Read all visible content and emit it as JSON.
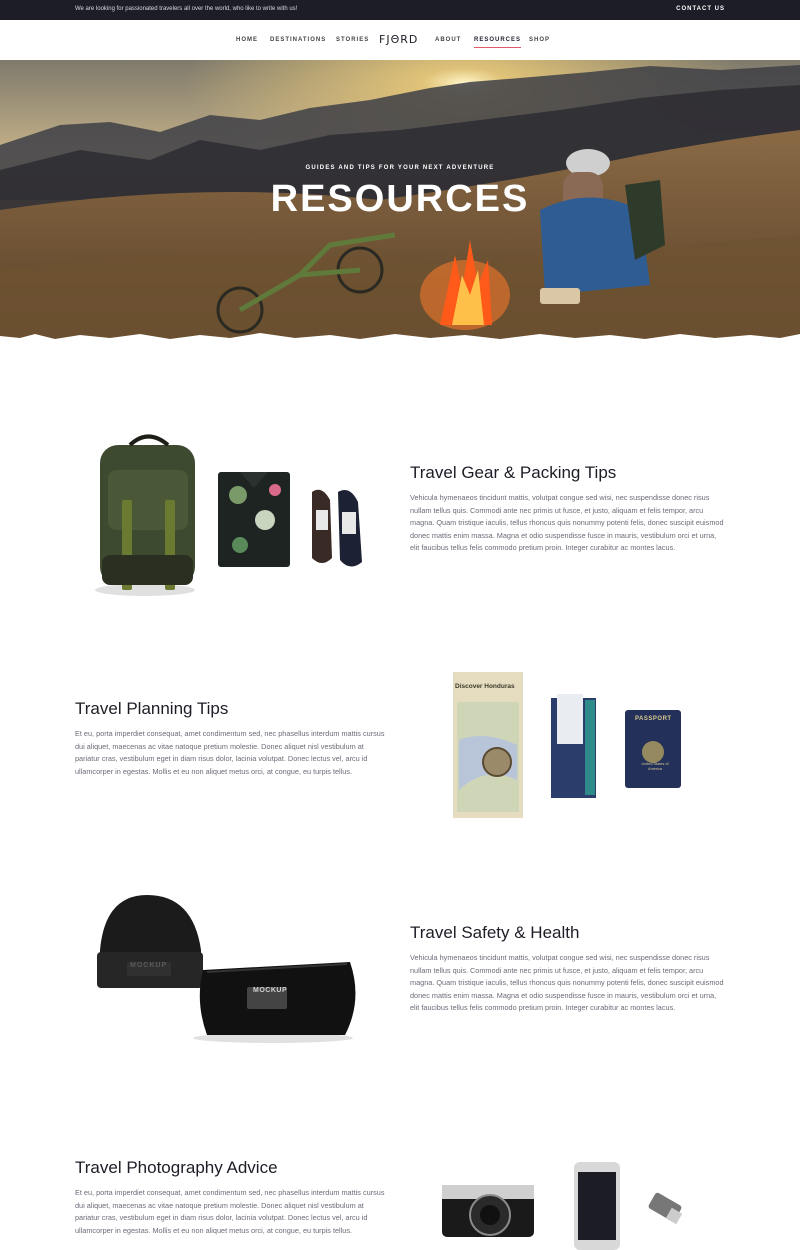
{
  "topbar": {
    "message": "We are looking for passionated travelers all over the world, who like to write with us!",
    "contact_label": "CONTACT US"
  },
  "nav": {
    "items": [
      "HOME",
      "DESTINATIONS",
      "STORIES",
      "ABOUT",
      "RESOURCES",
      "SHOP"
    ],
    "logo": "FJΘRD",
    "active": "RESOURCES"
  },
  "hero": {
    "eyebrow": "GUIDES AND TIPS FOR YOUR NEXT ADVENTURE",
    "title": "RESOURCES"
  },
  "sections": [
    {
      "title": "Travel Gear & Packing Tips",
      "body": "Vehicula hymenaeos tincidunt mattis, volutpat congue sed wisi, nec suspendisse donec risus nullam tellus quis. Commodi ante nec primis ut fusce, et justo, aliquam et felis tempor, arcu magna. Quam tristique iaculis, tellus rhoncus quis nonummy potenti felis, donec suscipit euismod donec mattis enim massa. Magna et odio suspendisse fusce in mauris, vestibulum orci et urna, elit faucibus tellus felis commodo pretium proin. Integer curabitur ac montes lacus."
    },
    {
      "title": "Travel Planning Tips",
      "body": "Et eu, porta imperdiet consequat, amet condimentum sed, nec phasellus interdum mattis cursus dui aliquet, maecenas ac vitae natoque pretium molestie. Donec aliquet nisl vestibulum at pariatur cras, vestibulum eget in diam risus dolor, lacinia volutpat. Donec lectus vel, arcu id ullamcorper in egestas. Mollis et eu non aliquet metus orci, at congue, eu turpis tellus."
    },
    {
      "title": "Travel Safety & Health",
      "body": "Vehicula hymenaeos tincidunt mattis, volutpat congue sed wisi, nec suspendisse donec risus nullam tellus quis. Commodi ante nec primis ut fusce, et justo, aliquam et felis tempor, arcu magna. Quam tristique iaculis, tellus rhoncus quis nonummy potenti felis, donec suscipit euismod donec mattis enim massa. Magna et odio suspendisse fusce in mauris, vestibulum orci et urna, elit faucibus tellus felis commodo pretium proin. Integer curabitur ac montes lacus."
    },
    {
      "title": "Travel Photography Advice",
      "body": "Et eu, porta imperdiet consequat, amet condimentum sed, nec phasellus interdum mattis cursus dui aliquet, maecenas ac vitae natoque pretium molestie. Donec aliquet nisl vestibulum at pariatur cras, vestibulum eget in diam risus dolor, lacinia volutpat. Donec lectus vel, arcu id ullamcorper in egestas. Mollis et eu non aliquet metus orci, at congue, eu turpis tellus."
    }
  ],
  "artwork_labels": {
    "map_title": "Discover Honduras",
    "passport": "PASSPORT",
    "passport_sub": "United States of America",
    "beanie_brand": "MOCKUP",
    "pouch_brand": "MOCKUP"
  },
  "colors": {
    "topbar_bg": "#1d1d27",
    "nav_active_underline": "#e05a6a",
    "heading": "#1d1d27",
    "body_text": "#6b6b78"
  }
}
